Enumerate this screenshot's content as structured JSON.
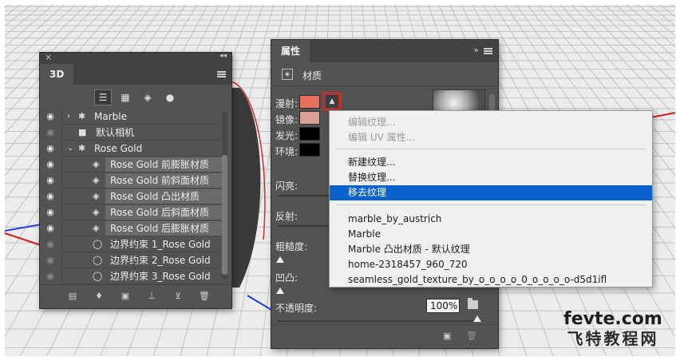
{
  "panel3d": {
    "title_tab": "3D",
    "filter_icons": [
      "scene-icon",
      "mesh-icon",
      "material-icon",
      "light-icon"
    ],
    "layers": [
      {
        "name": "Marble",
        "visible": true,
        "expanded": false,
        "type": "mesh",
        "highlighted": false
      },
      {
        "name": "默认相机",
        "visible": false,
        "type": "camera",
        "highlighted": false
      },
      {
        "name": "Rose Gold",
        "visible": true,
        "expanded": true,
        "type": "mesh",
        "highlighted": false
      },
      {
        "name": "Rose Gold 前膨胀材质",
        "visible": true,
        "type": "material",
        "highlighted": true
      },
      {
        "name": "Rose Gold 前斜面材质",
        "visible": true,
        "type": "material",
        "highlighted": true
      },
      {
        "name": "Rose Gold 凸出材质",
        "visible": true,
        "type": "material",
        "highlighted": true
      },
      {
        "name": "Rose Gold 后斜面材质",
        "visible": true,
        "type": "material",
        "highlighted": true
      },
      {
        "name": "Rose Gold 后膨胀材质",
        "visible": true,
        "type": "material",
        "highlighted": true
      },
      {
        "name": "边界约束 1_Rose Gold",
        "visible": false,
        "type": "constraint",
        "highlighted": false
      },
      {
        "name": "边界约束 2_Rose Gold",
        "visible": false,
        "type": "constraint",
        "highlighted": false
      },
      {
        "name": "边界约束 3_Rose Gold",
        "visible": false,
        "type": "constraint",
        "highlighted": false
      }
    ],
    "bottom_icons": [
      "new-mesh-icon",
      "new-light-icon",
      "render-icon",
      "ground-icon",
      "drop-icon",
      "trash-icon"
    ]
  },
  "properties": {
    "title_tab": "属性",
    "section_label": "材质",
    "rows": {
      "diffuse": "漫射:",
      "specular": "镜像:",
      "glow": "发光:",
      "ambient": "环境:",
      "shine": "闪亮:",
      "reflection": "反射:",
      "roughness": "粗糙度:",
      "bump": "凹凸:",
      "opacity": "不透明度:"
    },
    "opacity_value": "100%",
    "colors": {
      "diffuse": "#e8705a",
      "specular": "#d9a093",
      "glow": "#000000",
      "ambient": "#000000"
    }
  },
  "context_menu": {
    "items": [
      {
        "label": "编辑纹理...",
        "state": "disabled"
      },
      {
        "label": "编辑 UV 属性...",
        "state": "disabled"
      },
      {
        "label": "新建纹理...",
        "state": "normal"
      },
      {
        "label": "替换纹理...",
        "state": "normal"
      },
      {
        "label": "移去纹理",
        "state": "selected"
      },
      {
        "label": "marble_by_austrich",
        "state": "normal"
      },
      {
        "label": " Marble",
        "state": "normal"
      },
      {
        "label": " Marble 凸出材质 - 默认纹理",
        "state": "normal"
      },
      {
        "label": "home-2318457_960_720",
        "state": "normal"
      },
      {
        "label": "seamless_gold_texture_by_o_o_o_o_0_o_o_o_o-d5d1ifl",
        "state": "normal"
      }
    ]
  },
  "watermark": {
    "line1": "fevte.com",
    "line2": "飞特教程网"
  }
}
